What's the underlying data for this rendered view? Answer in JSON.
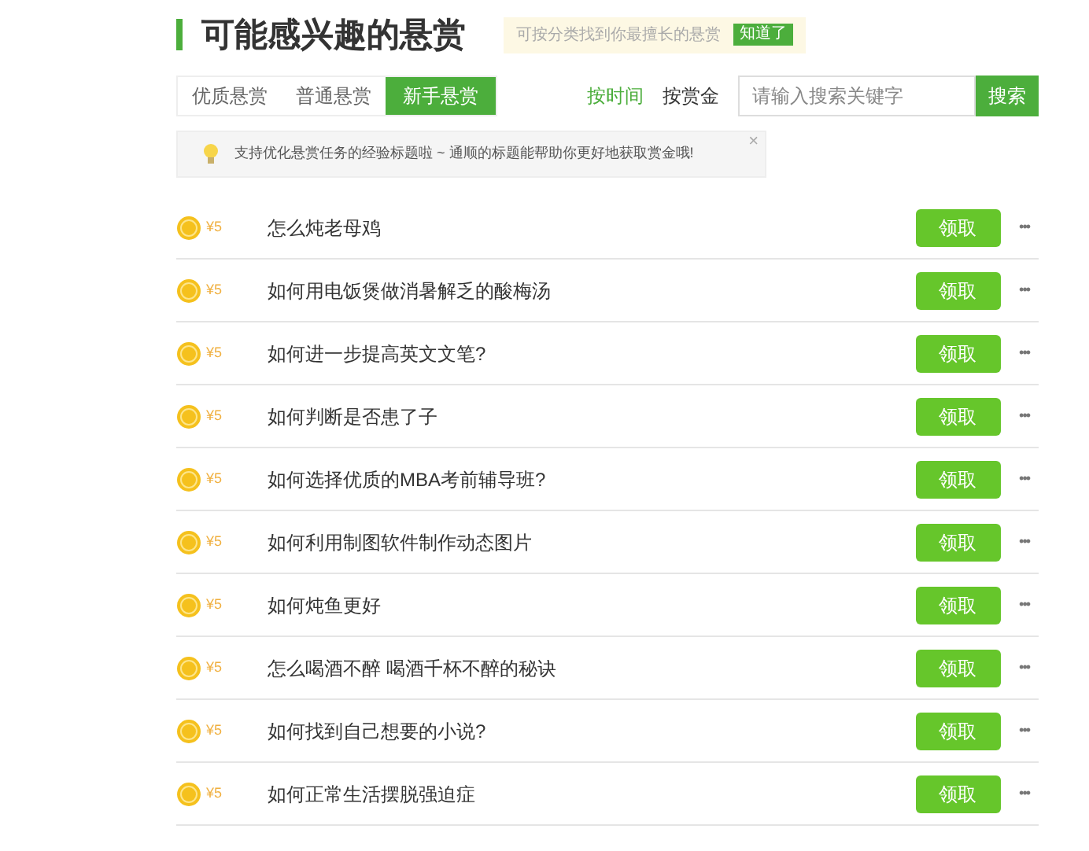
{
  "header": {
    "title": "可能感兴趣的悬赏",
    "tip": "可按分类找到你最擅长的悬赏",
    "tip_button": "知道了"
  },
  "tabs": [
    {
      "label": "优质悬赏",
      "selected": false
    },
    {
      "label": "普通悬赏",
      "selected": false
    },
    {
      "label": "新手悬赏",
      "selected": true
    }
  ],
  "sort": [
    {
      "label": "按时间",
      "selected": true
    },
    {
      "label": "按赏金",
      "selected": false
    }
  ],
  "search": {
    "placeholder": "请输入搜索关键字",
    "button": "搜索"
  },
  "notice": {
    "text": "支持优化悬赏任务的经验标题啦 ~ 通顺的标题能帮助你更好地获取赏金哦!",
    "close": "×"
  },
  "rows": [
    {
      "reward": "¥5",
      "title": "怎么炖老母鸡",
      "button": "领取",
      "more": "•••"
    },
    {
      "reward": "¥5",
      "title": "如何用电饭煲做消暑解乏的酸梅汤",
      "button": "领取",
      "more": "•••"
    },
    {
      "reward": "¥5",
      "title": "如何进一步提高英文文笔?",
      "button": "领取",
      "more": "•••"
    },
    {
      "reward": "¥5",
      "title": "如何判断是否患了子",
      "button": "领取",
      "more": "•••"
    },
    {
      "reward": "¥5",
      "title": "如何选择优质的MBA考前辅导班?",
      "button": "领取",
      "more": "•••"
    },
    {
      "reward": "¥5",
      "title": "如何利用制图软件制作动态图片",
      "button": "领取",
      "more": "•••"
    },
    {
      "reward": "¥5",
      "title": "如何炖鱼更好",
      "button": "领取",
      "more": "•••"
    },
    {
      "reward": "¥5",
      "title": "怎么喝酒不醉 喝酒千杯不醉的秘诀",
      "button": "领取",
      "more": "•••"
    },
    {
      "reward": "¥5",
      "title": "如何找到自己想要的小说?",
      "button": "领取",
      "more": "•••"
    },
    {
      "reward": "¥5",
      "title": "如何正常生活摆脱强迫症",
      "button": "领取",
      "more": "•••"
    }
  ]
}
